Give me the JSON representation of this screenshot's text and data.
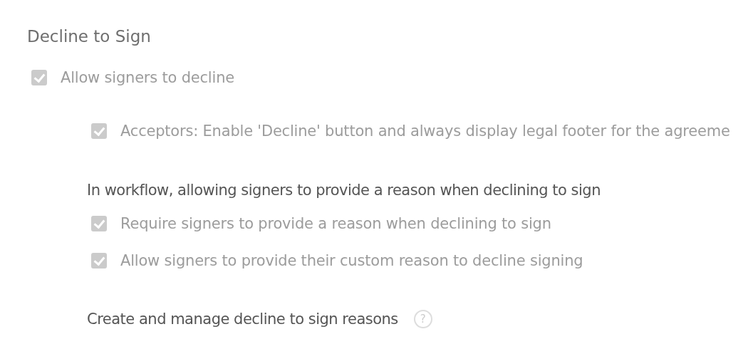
{
  "section_title": "Decline to Sign",
  "main_option": {
    "label": "Allow signers to decline",
    "checked": true,
    "disabled": true
  },
  "sub_options": [
    {
      "label": "Acceptors: Enable 'Decline' button and always display legal footer for the agreeme",
      "checked": true,
      "disabled": true
    }
  ],
  "workflow": {
    "heading": "In workflow, allowing signers to provide a reason when declining to sign",
    "options": [
      {
        "label": "Require signers to provide a reason when declining to sign",
        "checked": true,
        "disabled": true
      },
      {
        "label": "Allow signers to provide their custom reason to decline signing",
        "checked": true,
        "disabled": true
      }
    ]
  },
  "reasons": {
    "label": "Create and manage decline to sign reasons",
    "help": "?"
  }
}
